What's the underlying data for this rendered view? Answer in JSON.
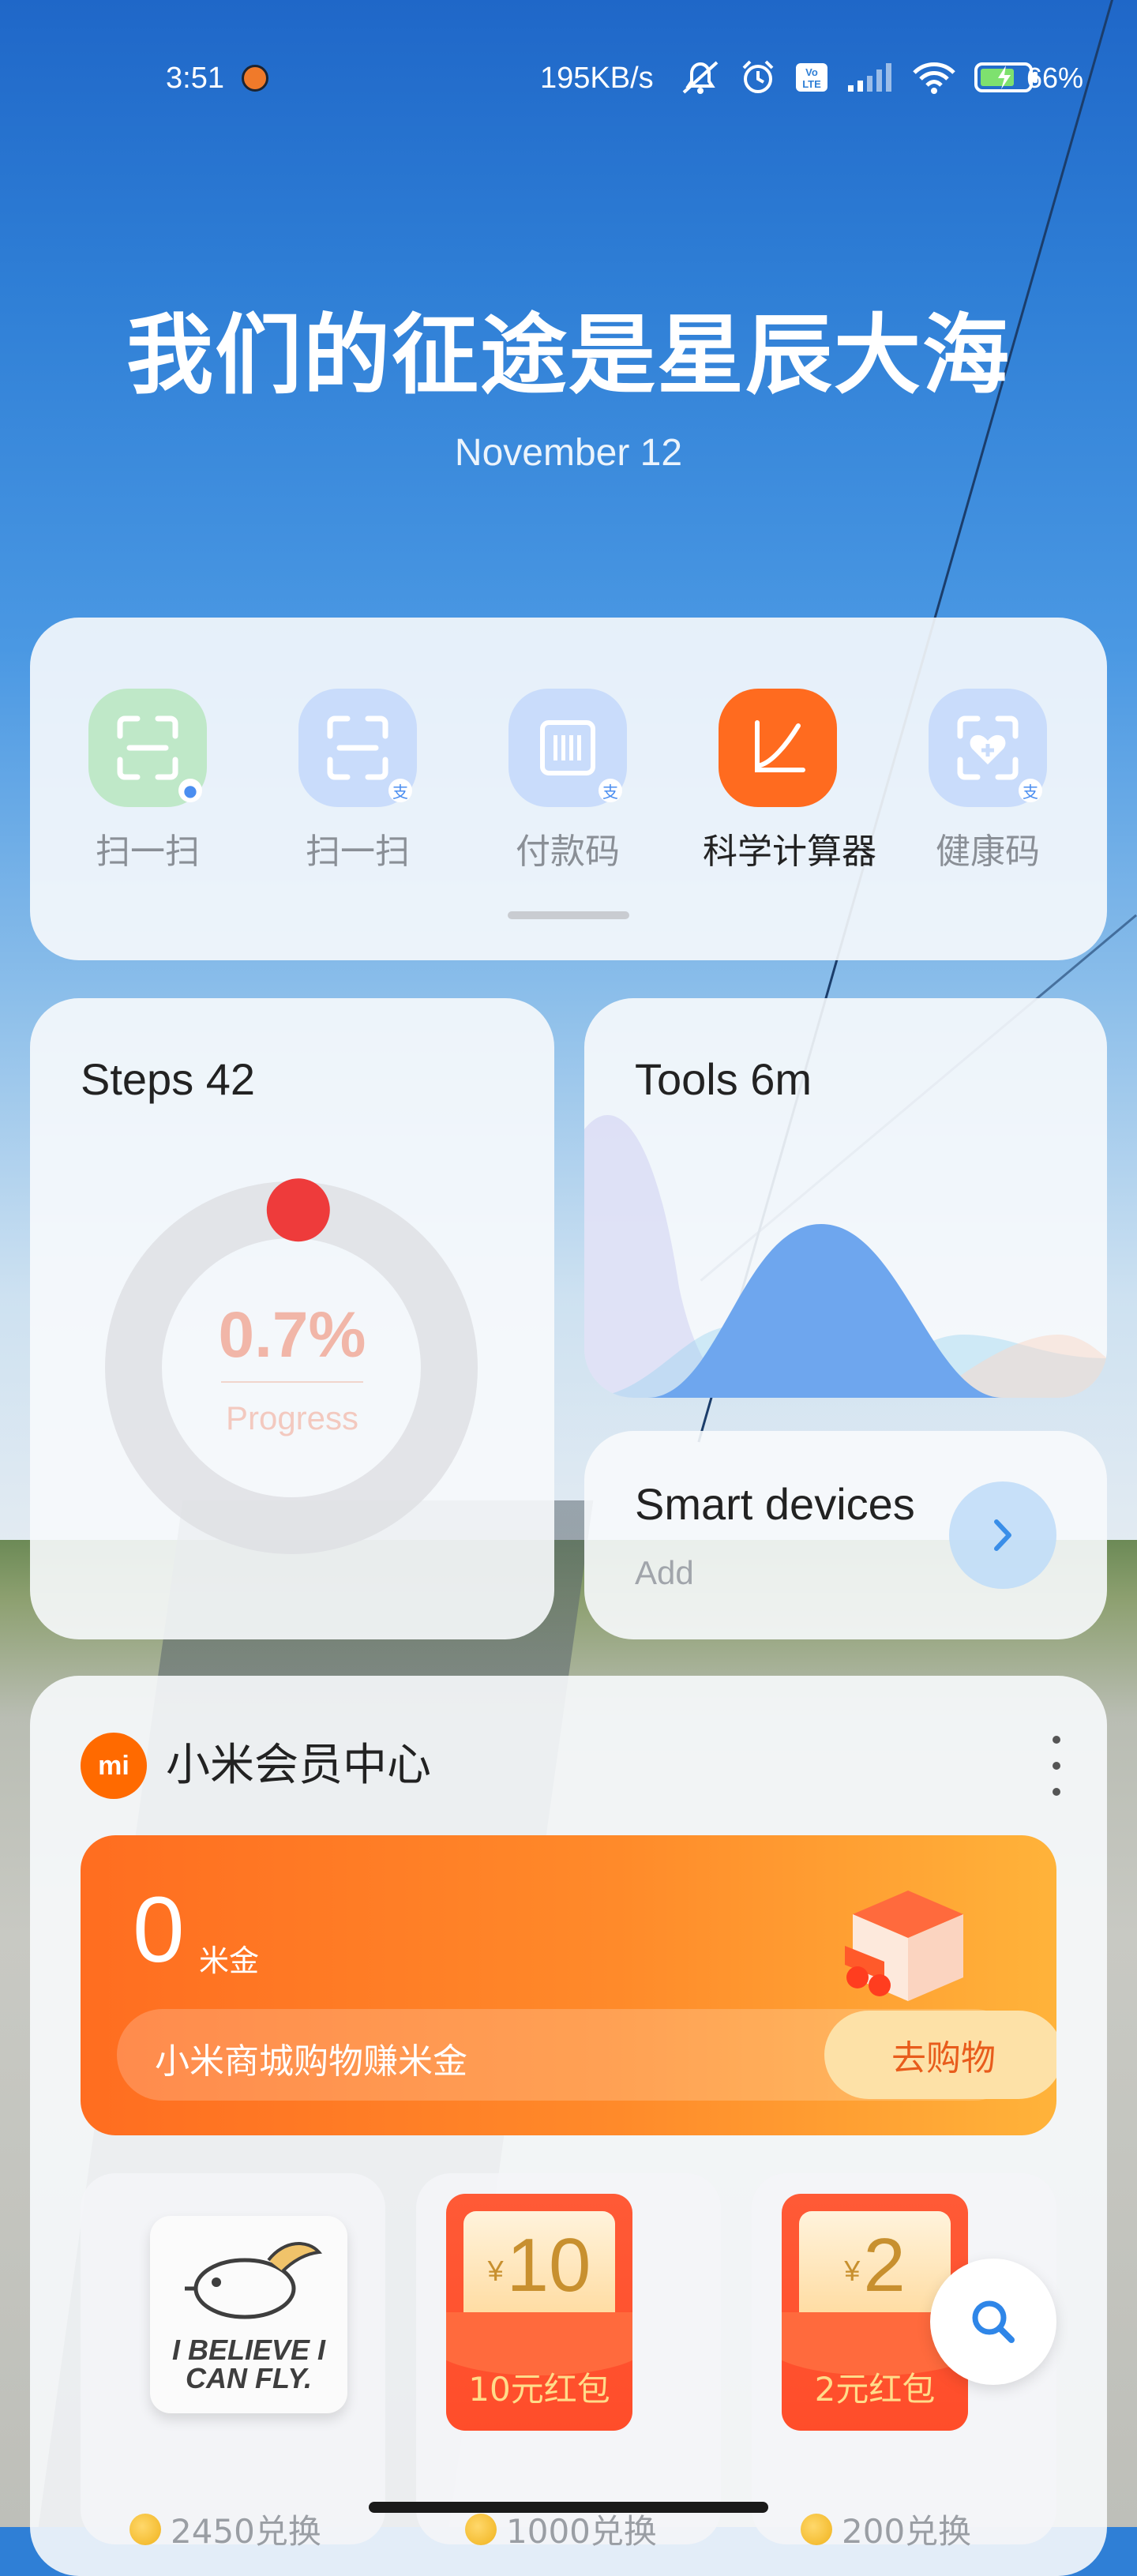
{
  "status_bar": {
    "time": "3:51",
    "net_speed": "195KB/s",
    "battery": "66%",
    "icons": [
      "mute-icon",
      "alarm-icon",
      "volte-icon",
      "signal-icon",
      "wifi-icon",
      "battery-charging-icon"
    ]
  },
  "header": {
    "headline": "我们的征途是星辰大海",
    "date": "November 12"
  },
  "shortcuts": {
    "items": [
      {
        "label": "扫一扫",
        "icon": "scan-icon",
        "color": "#bfe8c8"
      },
      {
        "label": "扫一扫",
        "icon": "scan-icon",
        "color": "#c9dcfb"
      },
      {
        "label": "付款码",
        "icon": "barcode-icon",
        "color": "#c9dcfb"
      },
      {
        "label": "科学计算器",
        "icon": "calculator-graph-icon",
        "color": "#ff6b1f"
      },
      {
        "label": "健康码",
        "icon": "health-code-icon",
        "color": "#c9dcfb"
      }
    ]
  },
  "steps": {
    "title": "Steps 42",
    "progress_value": "0.7%",
    "progress_label": "Progress",
    "progress_fraction": 0.007
  },
  "tools": {
    "title": "Tools 6m"
  },
  "smart_devices": {
    "title": "Smart devices",
    "subtitle": "Add"
  },
  "member": {
    "logo": "mi",
    "title": "小米会员中心",
    "points": "0",
    "points_unit": "米金",
    "promo_text": "小米商城购物赚米金",
    "shop_button": "去购物",
    "tiles": [
      {
        "name": "pillow",
        "image_text": "I BELIEVE I CAN FLY.",
        "cost": "2450兑换"
      },
      {
        "name": "red-packet-10",
        "yen": "¥",
        "value": "10",
        "label": "10元红包",
        "cost": "1000兑换"
      },
      {
        "name": "red-packet-2",
        "yen": "¥",
        "value": "2",
        "label": "2元红包",
        "cost": "200兑换"
      }
    ]
  },
  "colors": {
    "accent": "#ff6b1f",
    "mi_orange": "#ff6a00",
    "steps_dot": "#ee3b3b"
  }
}
